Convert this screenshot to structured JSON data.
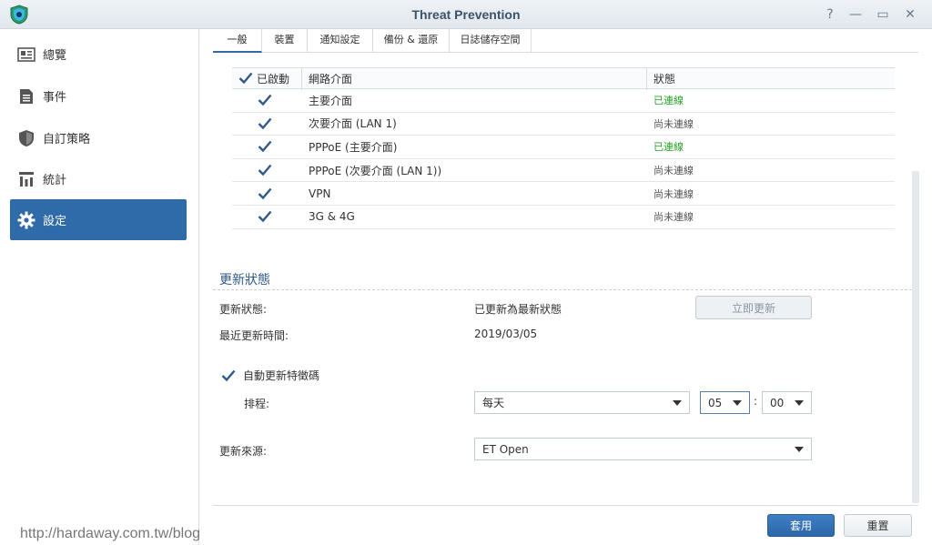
{
  "window": {
    "title": "Threat Prevention",
    "controls": [
      "?",
      "—",
      "▭",
      "✕"
    ]
  },
  "sidebar": {
    "items": [
      {
        "label": "總覽",
        "icon": "overview-icon"
      },
      {
        "label": "事件",
        "icon": "events-icon"
      },
      {
        "label": "自訂策略",
        "icon": "shield-icon"
      },
      {
        "label": "統計",
        "icon": "stats-icon"
      },
      {
        "label": "設定",
        "icon": "gear-icon",
        "active": true
      }
    ]
  },
  "tabs": [
    {
      "label": "一般",
      "active": true
    },
    {
      "label": "裝置"
    },
    {
      "label": "通知設定"
    },
    {
      "label": "備份 & 還原"
    },
    {
      "label": "日誌儲存空間"
    }
  ],
  "grid": {
    "headers": {
      "enabled": "已啟動",
      "interface": "網路介面",
      "status": "狀態"
    },
    "rows": [
      {
        "interface": "主要介面",
        "status": "已連線",
        "connected": true,
        "checked": true
      },
      {
        "interface": "次要介面 (LAN 1)",
        "status": "尚未連線",
        "connected": false,
        "checked": true
      },
      {
        "interface": "PPPoE (主要介面)",
        "status": "已連線",
        "connected": true,
        "checked": true
      },
      {
        "interface": "PPPoE (次要介面 (LAN 1))",
        "status": "尚未連線",
        "connected": false,
        "checked": true
      },
      {
        "interface": "VPN",
        "status": "尚未連線",
        "connected": false,
        "checked": true
      },
      {
        "interface": "3G & 4G",
        "status": "尚未連線",
        "connected": false,
        "checked": true
      }
    ]
  },
  "update": {
    "section_title": "更新狀態",
    "status_label": "更新狀態:",
    "status_value": "已更新為最新狀態",
    "update_now": "立即更新",
    "last_update_label": "最近更新時間:",
    "last_update_value": "2019/03/05",
    "auto_update_label": "自動更新特徵碼",
    "schedule_label": "排程:",
    "schedule_value": "每天",
    "hour": "05",
    "time_sep": ":",
    "minute": "00",
    "source_label": "更新來源:",
    "source_value": "ET Open"
  },
  "footer": {
    "apply": "套用",
    "reset": "重置"
  },
  "watermark": "http://hardaway.com.tw/blog",
  "colors": {
    "accent": "#2f6aa9",
    "connected": "#28a228",
    "title": "#3d5268"
  }
}
